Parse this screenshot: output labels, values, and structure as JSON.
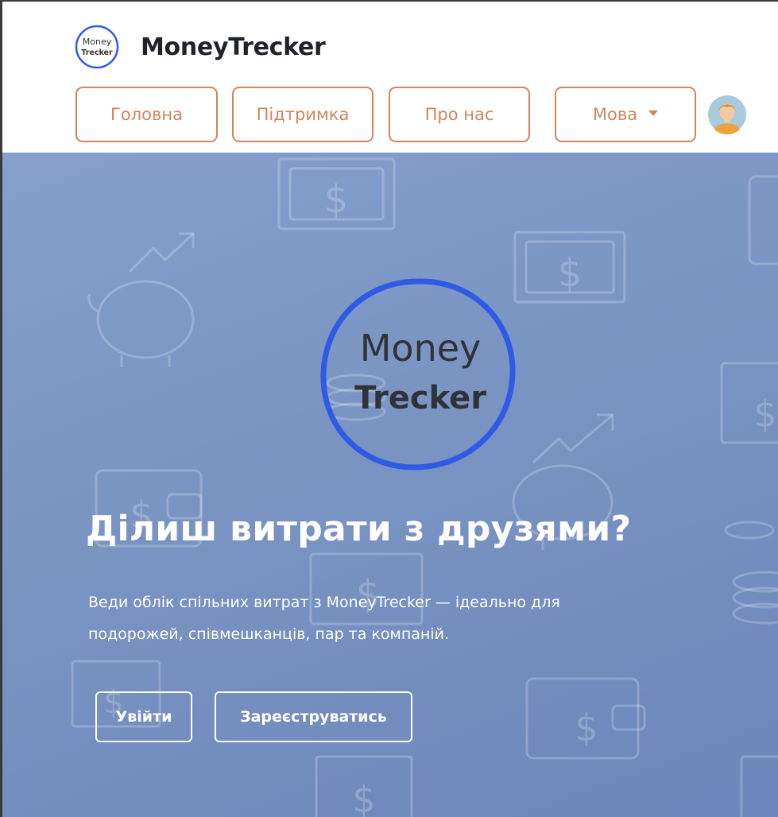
{
  "app": {
    "brand_name": "MoneyTrecker",
    "logo_text_line1": "Money",
    "logo_text_line2": "Trecker"
  },
  "nav": {
    "items": [
      {
        "label": "Головна"
      },
      {
        "label": "Підтримка"
      },
      {
        "label": "Про нас"
      }
    ],
    "language_label": "Мова"
  },
  "hero": {
    "logo_line1": "Money",
    "logo_line2": "Trecker",
    "title": "Ділиш витрати з друзями?",
    "description_line1": "Веди облік спільних витрат з MoneyTrecker — ідеально для",
    "description_line2": "подорожей, співмешканців, пар та компаній.",
    "login_label": "Увійти",
    "register_label": "Зареєструватись"
  },
  "icons": {
    "user_avatar": "user-avatar-icon",
    "dropdown": "caret-down-icon",
    "background": [
      "banknote-icon",
      "piggy-bank-icon",
      "growth-arrow-icon",
      "wallet-icon",
      "coin-stack-icon"
    ]
  },
  "colors": {
    "accent": "#d3845c",
    "hero_background": "#7b95c3",
    "logo_ring": "#2f5ae6",
    "text_dark": "#1f2229"
  }
}
